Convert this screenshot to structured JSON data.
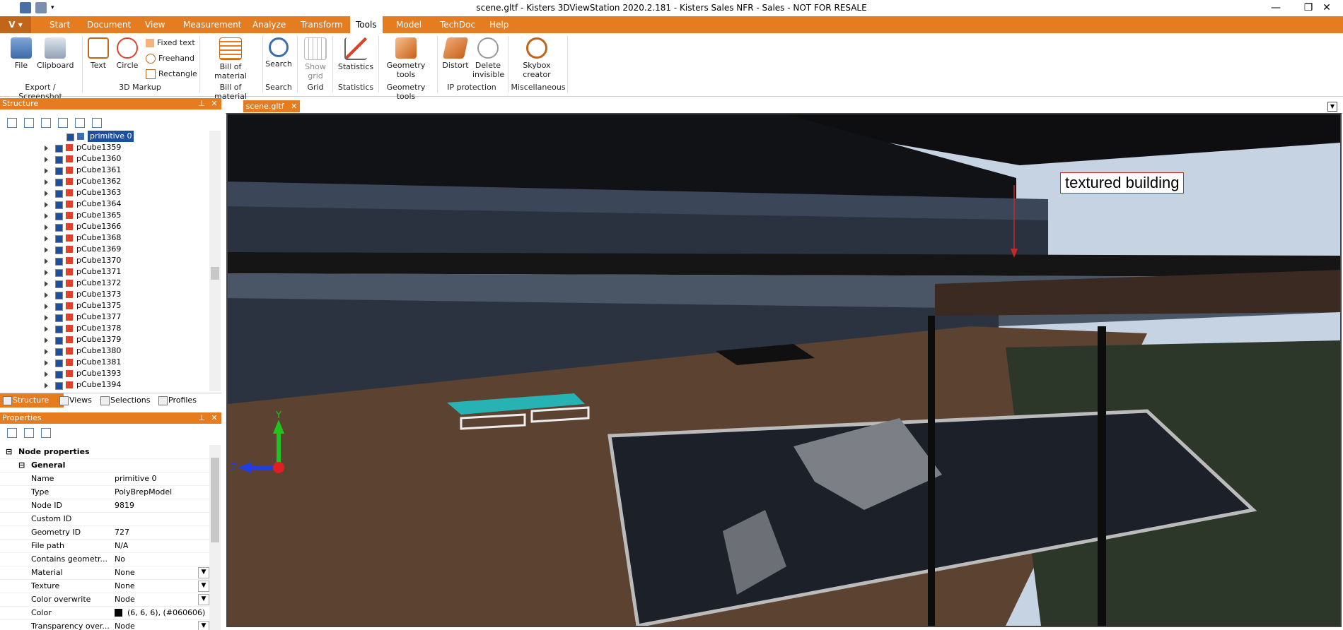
{
  "window": {
    "title": "scene.gltf - Kisters 3DViewStation 2020.2.181 - Kisters Sales NFR - Sales - NOT FOR RESALE",
    "minimize_label": "—",
    "restore_label": "❐",
    "close_label": "✕"
  },
  "menu": {
    "app_label": "V",
    "tabs": [
      "Start",
      "Document",
      "View",
      "Measurement",
      "Analyze",
      "Transform",
      "Tools",
      "Model",
      "TechDoc",
      "Help"
    ],
    "active": "Tools"
  },
  "ribbon": {
    "file": "File",
    "clipboard": "Clipboard",
    "text": "Text",
    "circle": "Circle",
    "fixed_text": "Fixed text",
    "freehand": "Freehand",
    "rectangle": "Rectangle",
    "bill_1": "Bill of",
    "bill_2": "material",
    "search": "Search",
    "show_1": "Show",
    "show_2": "grid",
    "statistics": "Statistics",
    "geom_1": "Geometry",
    "geom_2": "tools",
    "distort": "Distort",
    "delete_1": "Delete",
    "delete_2": "invisible",
    "skybox_1": "Skybox",
    "skybox_2": "creator",
    "groups": {
      "export": "Export / Screenshot",
      "markup": "3D Markup",
      "bill": "Bill of material",
      "search": "Search",
      "grid": "Grid",
      "statistics": "Statistics",
      "geometry": "Geometry tools",
      "ip": "IP protection",
      "misc": "Miscellaneous"
    }
  },
  "structure": {
    "title": "Structure",
    "selected": "primitive 0",
    "items": [
      "pCube1359",
      "pCube1360",
      "pCube1361",
      "pCube1362",
      "pCube1363",
      "pCube1364",
      "pCube1365",
      "pCube1366",
      "pCube1368",
      "pCube1369",
      "pCube1370",
      "pCube1371",
      "pCube1372",
      "pCube1373",
      "pCube1375",
      "pCube1377",
      "pCube1378",
      "pCube1379",
      "pCube1380",
      "pCube1381",
      "pCube1393",
      "pCube1394"
    ]
  },
  "bottom_tabs": [
    "Structure",
    "Views",
    "Selections",
    "Profiles"
  ],
  "properties": {
    "title": "Properties",
    "section": "Node properties",
    "group": "General",
    "rows": [
      {
        "k": "Name",
        "v": "primitive 0"
      },
      {
        "k": "Type",
        "v": "PolyBrepModel"
      },
      {
        "k": "Node ID",
        "v": "9819"
      },
      {
        "k": "Custom ID",
        "v": ""
      },
      {
        "k": "Geometry ID",
        "v": "727"
      },
      {
        "k": "File path",
        "v": "N/A"
      },
      {
        "k": "Contains geometr...",
        "v": "No"
      },
      {
        "k": "Material",
        "v": "None"
      },
      {
        "k": "Texture",
        "v": "None"
      },
      {
        "k": "Color overwrite",
        "v": "Node"
      },
      {
        "k": "Color",
        "v": "(6, 6, 6), (#060606)"
      },
      {
        "k": "Transparency over...",
        "v": "Node"
      }
    ]
  },
  "document": {
    "tab": "scene.gltf",
    "callout": "textured building",
    "axes": {
      "y": "Y",
      "z": "Z"
    }
  },
  "colors": {
    "accent": "#e57c1f",
    "bench_selected": "#27b3b3",
    "callout_border": "#c62828"
  }
}
